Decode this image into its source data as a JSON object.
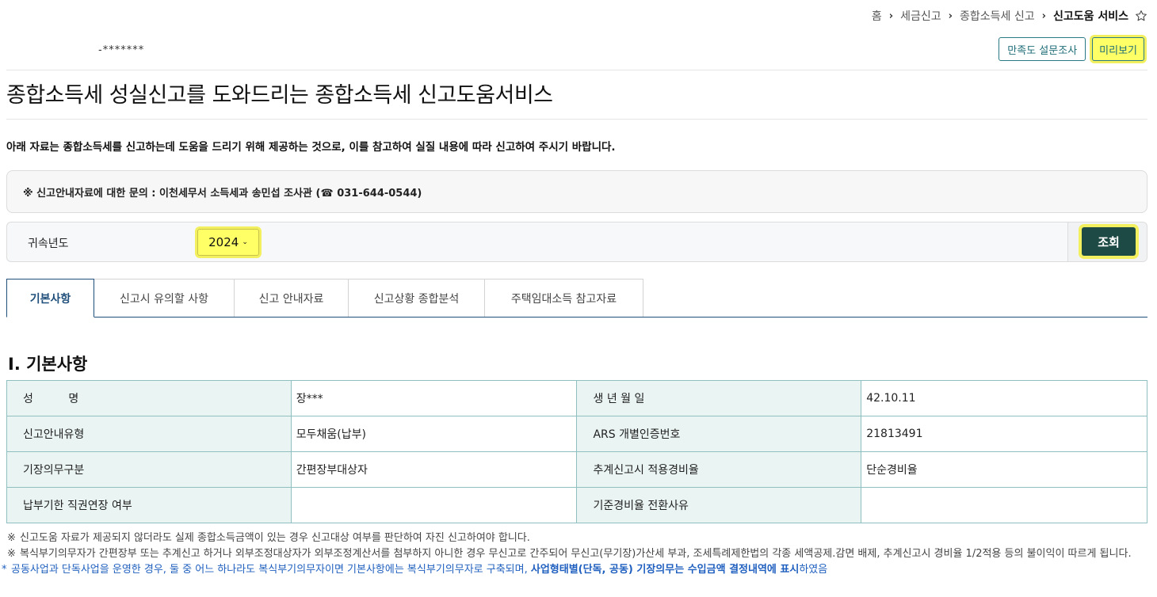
{
  "breadcrumb": {
    "items": [
      "홈",
      "세금신고",
      "종합소득세 신고",
      "신고도움 서비스"
    ],
    "separator": "›",
    "favorite_icon": "star-outline-icon"
  },
  "user": {
    "masked_id": "-*******"
  },
  "top_buttons": {
    "survey": "만족도 설문조사",
    "preview": "미리보기"
  },
  "page": {
    "title": "종합소득세 성실신고를 도와드리는 종합소득세 신고도움서비스",
    "notice": "아래 자료는 종합소득세를 신고하는데 도움을 드리기 위해 제공하는 것으로, 이를 참고하여 실질 내용에 따라 신고하여 주시기 바랍니다.",
    "inquiry": "※ 신고안내자료에 대한 문의 : 이천세무서 소득세과 송민섭 조사관 (☎ 031-644-0544)"
  },
  "year_filter": {
    "label": "귀속년도",
    "selected": "2024",
    "search_label": "조회"
  },
  "tabs": [
    "기본사항",
    "신고시 유의할 사항",
    "신고 안내자료",
    "신고상황 종합분석",
    "주택임대소득 참고자료"
  ],
  "section": {
    "title": "Ⅰ. 기본사항"
  },
  "basic_info": {
    "rows": [
      {
        "l1": "성          명",
        "v1": "장***",
        "l2": "생 년 월 일",
        "v2": "42.10.11"
      },
      {
        "l1": "신고안내유형",
        "v1": "모두채움(납부)",
        "l2": "ARS 개별인증번호",
        "v2": "21813491"
      },
      {
        "l1": "기장의무구분",
        "v1": "간편장부대상자",
        "l2": "추계신고시 적용경비율",
        "v2": "단순경비율"
      },
      {
        "l1": "납부기한 직권연장 여부",
        "v1": "",
        "l2": "기준경비율 전환사유",
        "v2": ""
      }
    ]
  },
  "notes": {
    "n1": "신고도움 자료가 제공되지 않더라도 실제 종합소득금액이 있는 경우 신고대상 여부를 판단하여 자진 신고하여야 합니다.",
    "n2": "복식부기의무자가 간편장부 또는 추계신고 하거나 외부조정대상자가 외부조정계산서를 첨부하지 아니한 경우 무신고로 간주되어 무신고(무기장)가산세 부과, 조세특례제한법의 각종 세액공제.감면 배제, 추계신고시 경비율 1/2적용 등의 불이익이 따르게 됩니다.",
    "n3_plain": "공동사업과 단독사업을 운영한 경우, 둘 중 어느 하나라도 복식부기의무자이면 기본사항에는 복식부기의무자로 구축되며, ",
    "n3_bold": "사업형태별(단독, 공동) 기장의무는 수입금액 결정내역에 표시",
    "n3_tail": "하였음",
    "mark": "※",
    "mark3": "*"
  }
}
